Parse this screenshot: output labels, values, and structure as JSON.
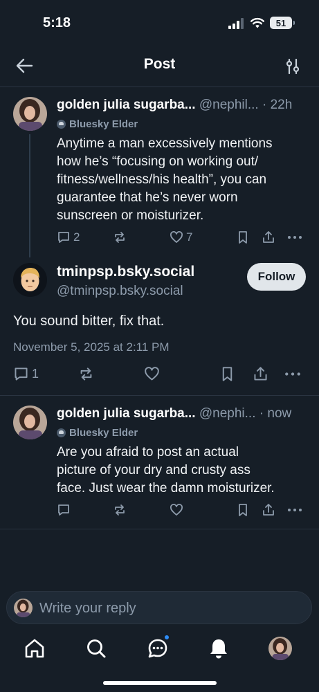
{
  "status_bar": {
    "time": "5:18",
    "battery": "51"
  },
  "header": {
    "title": "Post"
  },
  "posts": [
    {
      "display_name": "golden julia sugarba...",
      "handle": "@nephil...",
      "time": "· 22h",
      "badge": "Bluesky Elder",
      "text_lines": [
        "Anytime a man excessively mentions",
        "how he’s “focusing on working out/",
        "fitness/wellness/his health”, you can",
        "guarantee that he’s never worn",
        "sunscreen or moisturizer."
      ],
      "reply_count": "2",
      "repost_count": "",
      "like_count": "7"
    },
    {
      "display_name": "golden julia sugarba...",
      "handle": "@nephi...",
      "time": "· now",
      "badge": "Bluesky Elder",
      "text_lines": [
        "Are you afraid to post an actual",
        "picture of your dry and crusty ass",
        "face. Just wear the damn moisturizer."
      ],
      "reply_count": "",
      "repost_count": "",
      "like_count": ""
    }
  ],
  "main_post": {
    "display_name": "tminpsp.bsky.social",
    "handle": "@tminpsp.bsky.social",
    "follow_label": "Follow",
    "text": "You sound bitter, fix that.",
    "date": "November 5, 2025 at 2:11 PM",
    "reply_count": "1"
  },
  "composer": {
    "placeholder": "Write your reply"
  },
  "colors": {
    "background": "#161e27",
    "muted": "#8d9bab",
    "accent": "#2e8cf6",
    "follow_bg": "#e1e6ea"
  },
  "icons": {
    "back": "arrow-left-icon",
    "filter": "sliders-icon",
    "reply": "speech-bubble-icon",
    "repost": "repost-icon",
    "like": "heart-icon",
    "bookmark": "bookmark-icon",
    "share": "share-icon",
    "more": "ellipsis-icon",
    "home": "home-icon",
    "search": "search-icon",
    "chat": "chat-icon",
    "notifications": "bell-icon"
  }
}
